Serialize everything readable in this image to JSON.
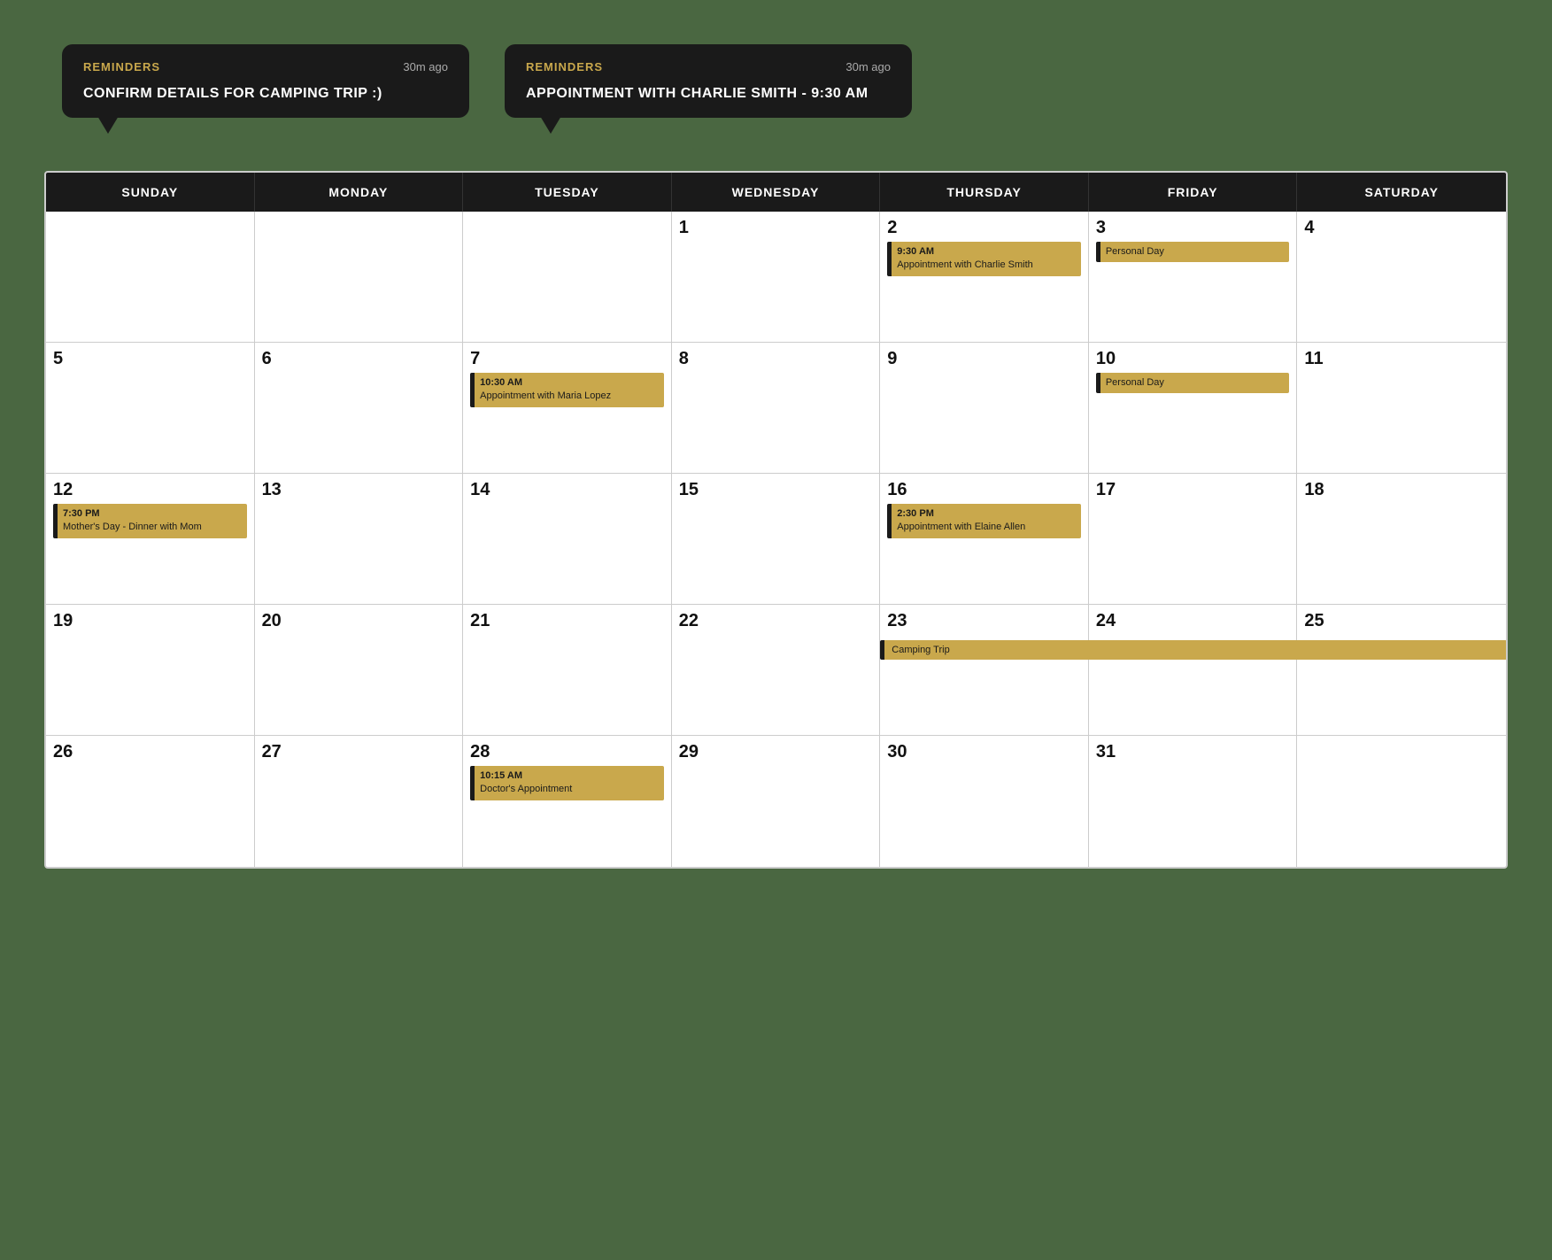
{
  "notifications": [
    {
      "id": "notif-1",
      "label": "REMINDERS",
      "time": "30m ago",
      "text": "CONFIRM DETAILS FOR CAMPING TRIP :)"
    },
    {
      "id": "notif-2",
      "label": "REMINDERS",
      "time": "30m ago",
      "text": "APPOINTMENT WITH CHARLIE SMITH - 9:30 AM"
    }
  ],
  "calendar": {
    "headers": [
      "SUNDAY",
      "MONDAY",
      "TUESDAY",
      "WEDNESDAY",
      "THURSDAY",
      "FRIDAY",
      "SATURDAY"
    ],
    "weeks": [
      {
        "id": "week-1",
        "cells": [
          {
            "day": "",
            "events": []
          },
          {
            "day": "",
            "events": []
          },
          {
            "day": "",
            "events": []
          },
          {
            "day": "1",
            "events": []
          },
          {
            "day": "2",
            "events": [
              {
                "time": "9:30 AM",
                "title": "Appointment with Charlie Smith"
              }
            ]
          },
          {
            "day": "3",
            "events": [
              {
                "time": "",
                "title": "Personal Day"
              }
            ]
          },
          {
            "day": "4",
            "events": []
          }
        ]
      },
      {
        "id": "week-2",
        "cells": [
          {
            "day": "5",
            "events": []
          },
          {
            "day": "6",
            "events": []
          },
          {
            "day": "7",
            "events": [
              {
                "time": "10:30 AM",
                "title": "Appointment with Maria Lopez"
              }
            ]
          },
          {
            "day": "8",
            "events": []
          },
          {
            "day": "9",
            "events": []
          },
          {
            "day": "10",
            "events": [
              {
                "time": "",
                "title": "Personal Day"
              }
            ]
          },
          {
            "day": "11",
            "events": []
          }
        ]
      },
      {
        "id": "week-3",
        "cells": [
          {
            "day": "12",
            "events": [
              {
                "time": "7:30 PM",
                "title": "Mother's Day - Dinner with Mom"
              }
            ]
          },
          {
            "day": "13",
            "events": []
          },
          {
            "day": "14",
            "events": []
          },
          {
            "day": "15",
            "events": []
          },
          {
            "day": "16",
            "events": [
              {
                "time": "2:30 PM",
                "title": "Appointment with Elaine Allen"
              }
            ]
          },
          {
            "day": "17",
            "events": []
          },
          {
            "day": "18",
            "events": []
          }
        ]
      },
      {
        "id": "week-4",
        "cells": [
          {
            "day": "19",
            "events": []
          },
          {
            "day": "20",
            "events": []
          },
          {
            "day": "21",
            "events": []
          },
          {
            "day": "22",
            "events": []
          },
          {
            "day": "23",
            "events": [
              {
                "time": "",
                "title": "Camping Trip",
                "span": true
              }
            ]
          },
          {
            "day": "24",
            "events": []
          },
          {
            "day": "25",
            "events": []
          }
        ]
      },
      {
        "id": "week-5",
        "cells": [
          {
            "day": "26",
            "events": []
          },
          {
            "day": "27",
            "events": []
          },
          {
            "day": "28",
            "events": [
              {
                "time": "10:15 AM",
                "title": "Doctor's Appointment"
              }
            ]
          },
          {
            "day": "29",
            "events": []
          },
          {
            "day": "30",
            "events": []
          },
          {
            "day": "31",
            "events": []
          },
          {
            "day": "",
            "events": []
          }
        ]
      }
    ]
  },
  "colors": {
    "accent": "#c9a84c",
    "dark": "#1a1a1a",
    "green": "#4a6741"
  }
}
